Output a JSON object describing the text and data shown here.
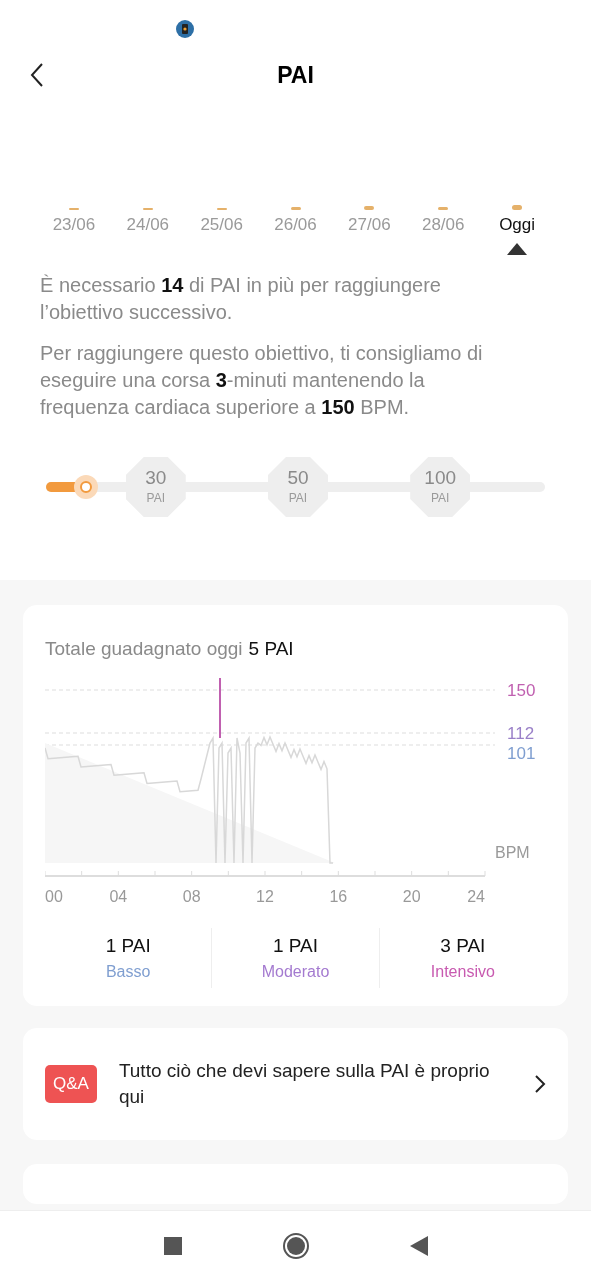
{
  "header": {
    "title": "PAI"
  },
  "days": [
    {
      "label": "23/06",
      "selected": false
    },
    {
      "label": "24/06",
      "selected": false
    },
    {
      "label": "25/06",
      "selected": false
    },
    {
      "label": "26/06",
      "selected": false
    },
    {
      "label": "27/06",
      "selected": false
    },
    {
      "label": "28/06",
      "selected": false
    },
    {
      "label": "Oggi",
      "selected": true
    }
  ],
  "messages": [
    "È necessario **14** di PAI in più per raggiungere l’obiettivo successivo.",
    "Per raggiungere questo obiettivo, ti consigliamo di eseguire una corsa **3**-minuti mantenendo la frequenza cardiaca superiore a **150** BPM."
  ],
  "progress": {
    "level": 0.08,
    "milestones": [
      {
        "value": "30",
        "unit": "PAI"
      },
      {
        "value": "50",
        "unit": "PAI"
      },
      {
        "value": "100",
        "unit": "PAI"
      }
    ]
  },
  "today": {
    "label": "Totale guadagnato oggi",
    "total": "5 PAI",
    "reference_lines": [
      {
        "label": "150",
        "color": "#c060b0"
      },
      {
        "label": "112",
        "color": "#9a80c8"
      },
      {
        "label": "101",
        "color": "#7f9ed0"
      }
    ],
    "unit": "BPM",
    "x_ticks": [
      "00",
      "04",
      "08",
      "12",
      "16",
      "20",
      "24"
    ],
    "zones": [
      {
        "value": "1 PAI",
        "name": "Basso",
        "color": "#7f9ed0"
      },
      {
        "value": "1 PAI",
        "name": "Moderato",
        "color": "#a47ad0"
      },
      {
        "value": "3 PAI",
        "name": "Intensivo",
        "color": "#c85ab0"
      }
    ]
  },
  "qa": {
    "badge": "Q&A",
    "text": "Tutto ciò che devi sapere sulla PAI è proprio qui"
  }
}
